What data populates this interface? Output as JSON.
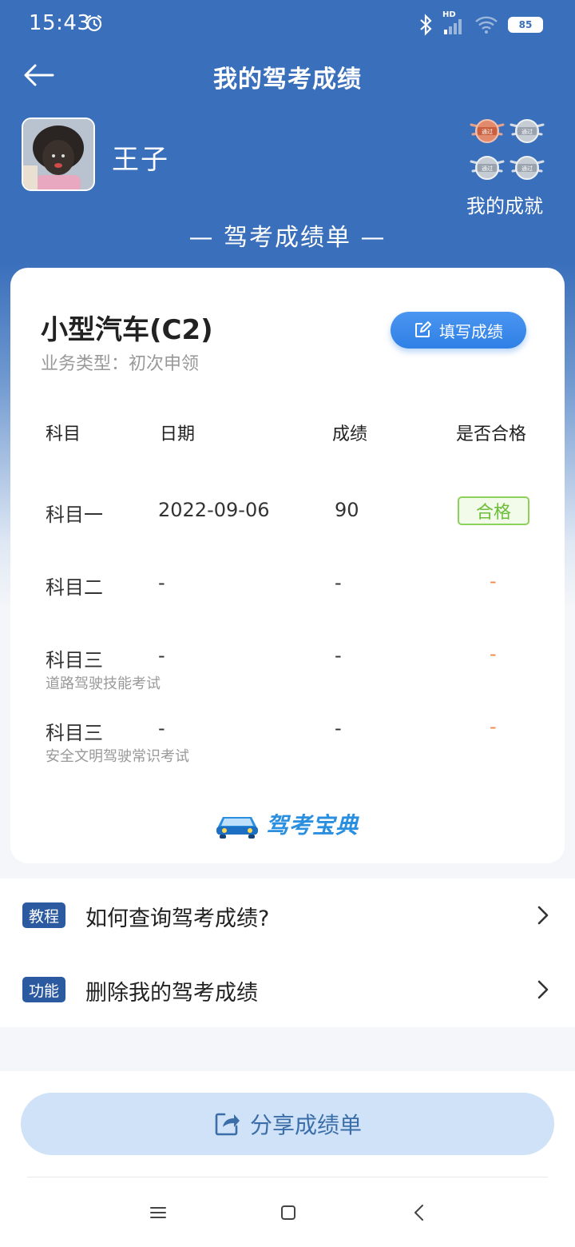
{
  "status": {
    "time": "15:43",
    "net_tag": "HD",
    "battery": "85"
  },
  "header": {
    "title": "我的驾考成绩"
  },
  "profile": {
    "name": "王子",
    "achievements_label": "我的成就",
    "badge_text": "通过"
  },
  "sheet_title": "— 驾考成绩单 —",
  "card": {
    "car_type": "小型汽车(C2)",
    "business_type": "业务类型：初次申领",
    "fill_button": "填写成绩",
    "columns": [
      "科目",
      "日期",
      "成绩",
      "是否合格"
    ],
    "rows": [
      {
        "subject": "科目一",
        "note": "",
        "date": "2022-09-06",
        "score": "90",
        "result": "合格"
      },
      {
        "subject": "科目二",
        "note": "",
        "date": "-",
        "score": "-",
        "result": "-"
      },
      {
        "subject": "科目三",
        "note": "道路驾驶技能考试",
        "date": "-",
        "score": "-",
        "result": "-"
      },
      {
        "subject": "科目三",
        "note": "安全文明驾驶常识考试",
        "date": "-",
        "score": "-",
        "result": "-"
      }
    ],
    "brand": "驾考宝典"
  },
  "links": [
    {
      "tag": "教程",
      "text": "如何查询驾考成绩?"
    },
    {
      "tag": "功能",
      "text": "删除我的驾考成绩"
    }
  ],
  "share_button": "分享成绩单",
  "colors": {
    "header_blue": "#3a6fbb",
    "accent_blue": "#2f80e6",
    "pass_green": "#6dbd3a",
    "dash_orange": "#f08a4b"
  }
}
